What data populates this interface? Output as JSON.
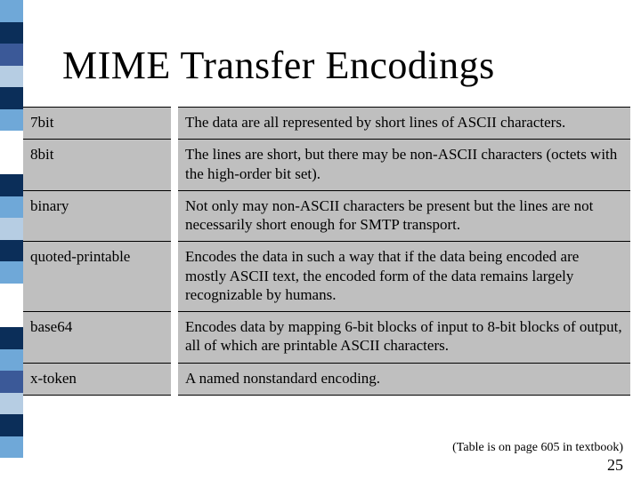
{
  "title": "MIME Transfer Encodings",
  "rows": [
    {
      "name": "7bit",
      "desc": "The data are all represented by short lines of ASCII characters."
    },
    {
      "name": "8bit",
      "desc": "The lines are short, but there may be non-ASCII characters (octets with the high-order bit set)."
    },
    {
      "name": "binary",
      "desc": "Not only may non-ASCII characters be present but the lines are not necessarily short enough for SMTP transport."
    },
    {
      "name": "quoted-printable",
      "desc": "Encodes the data in such a way that if the data being encoded are mostly ASCII text, the encoded form of the data remains largely recognizable by humans."
    },
    {
      "name": "base64",
      "desc": "Encodes data by mapping 6-bit blocks of input to 8-bit blocks of output, all of which are printable ASCII characters."
    },
    {
      "name": "x-token",
      "desc": "A named nonstandard encoding."
    }
  ],
  "caption": "(Table is on page 605 in textbook)",
  "page_number": "25",
  "stripe_colors": [
    "#6fa8d8",
    "#0b2e59",
    "#3b5998",
    "#b6cde3",
    "#0b2e59",
    "#6fa8d8",
    "#ffffff",
    "#ffffff",
    "#0b2e59",
    "#6fa8d8",
    "#b6cde3",
    "#0b2e59",
    "#6fa8d8",
    "#ffffff",
    "#ffffff",
    "#0b2e59",
    "#6fa8d8",
    "#3b5998",
    "#b6cde3",
    "#0b2e59",
    "#6fa8d8",
    "#ffffff"
  ]
}
